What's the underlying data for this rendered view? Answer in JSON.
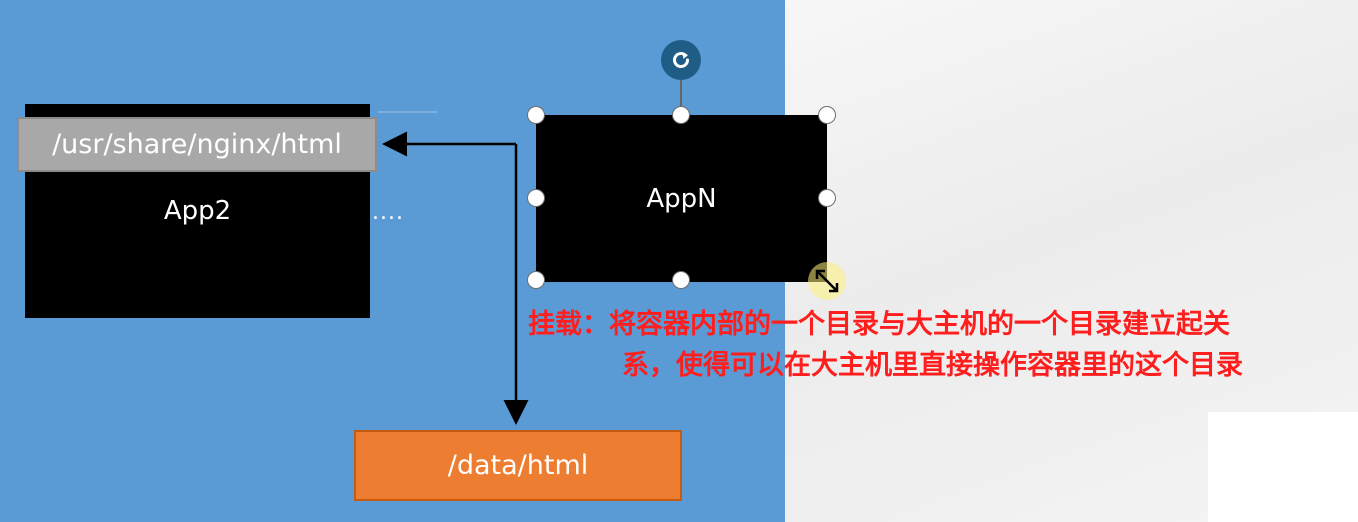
{
  "diagram": {
    "app2_label": "App2",
    "container_path": "/usr/share/nginx/html",
    "ellipsis": "....",
    "appn_label": "AppN",
    "host_path": "/data/html"
  },
  "annotation": {
    "line1": "挂载：将容器内部的一个目录与大主机的一个目录建立起关",
    "line2": "系，使得可以在大主机里直接操作容器里的这个目录"
  },
  "colors": {
    "slide_background": "#5b9bd5",
    "container_box": "#000000",
    "path_box": "#a8a8a8",
    "host_box": "#ed7d31",
    "annotation_text": "#ff1e1e"
  }
}
